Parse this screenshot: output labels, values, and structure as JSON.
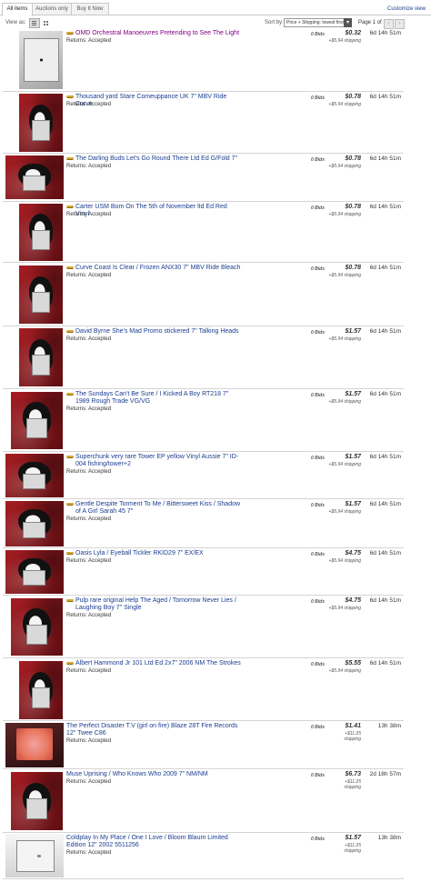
{
  "tabs": [
    "All items",
    "Auctions only",
    "Buy It Now"
  ],
  "customize_label": "Customize view",
  "toolbar": {
    "view_as": "View as:",
    "sort_by": "Sort by:",
    "sort_value": "Price + Shipping: lowest first",
    "page_info": "Page 1 of 1"
  },
  "listings": [
    {
      "title": "OMD Orchestral Manoeuvres Pretending to See The Light",
      "returns": "Returns: Accepted",
      "bids": "0 Bids",
      "price": "$0.32",
      "shipping": "+$5.94 shipping",
      "time": "6d 14h 51m",
      "auction_icon": true,
      "visited": true,
      "thumb": "white"
    },
    {
      "title": "Thousand yard Stare Comeuppance UK 7\" MBV Ride Curve",
      "returns": "Returns: Accepted",
      "bids": "0 Bids",
      "price": "$0.78",
      "shipping": "+$5.94 shipping",
      "time": "6d 14h 51m",
      "auction_icon": true,
      "thumb": "cat"
    },
    {
      "title": "The Darling Buds Let's Go Round There Ltd Ed G/Fold 7\"",
      "returns": "Returns: Accepted",
      "bids": "0 Bids",
      "price": "$0.78",
      "shipping": "+$5.94 shipping",
      "time": "6d 14h 51m",
      "auction_icon": true,
      "thumb": "cat"
    },
    {
      "title": "Carter USM Bom On The 5th of November ltd Ed Red Vinyl",
      "returns": "Returns: Accepted",
      "bids": "0 Bids",
      "price": "$0.78",
      "shipping": "+$5.94 shipping",
      "time": "6d 14h 51m",
      "auction_icon": true,
      "thumb": "cat"
    },
    {
      "title": "Curve Coast Is Clear / Frozen ANX30 7\" MBV Ride Bleach",
      "returns": "Returns: Accepted",
      "bids": "0 Bids",
      "price": "$0.78",
      "shipping": "+$5.94 shipping",
      "time": "6d 14h 51m",
      "auction_icon": true,
      "thumb": "cat"
    },
    {
      "title": "David Byrne She's Mad Promo stickered 7\" Talking Heads",
      "returns": "Returns: Accepted",
      "bids": "0 Bids",
      "price": "$1.57",
      "shipping": "+$5.94 shipping",
      "time": "6d 14h 51m",
      "auction_icon": true,
      "thumb": "cat"
    },
    {
      "title": "The Sundays Can't Be Sure / I Kicked A Boy RT218 7\" 1989 Rough Trade VG/VG",
      "returns": "Returns: Accepted",
      "bids": "0 Bids",
      "price": "$1.57",
      "shipping": "+$5.94 shipping",
      "time": "6d 14h 51m",
      "auction_icon": true,
      "thumb": "cat"
    },
    {
      "title": "Superchunk very rare Tower EP yellow Vinyl Aussie 7\" ID-004 fishing/tower+2",
      "returns": "Returns: Accepted",
      "bids": "0 Bids",
      "price": "$1.57",
      "shipping": "+$5.94 shipping",
      "time": "6d 14h 51m",
      "auction_icon": true,
      "thumb": "cat"
    },
    {
      "title": "Gentle Despite Torment To Me / Bittersweet Kiss / Shadow of A Girl Sarah 45 7\"",
      "returns": "Returns: Accepted",
      "bids": "0 Bids",
      "price": "$1.57",
      "shipping": "+$5.94 shipping",
      "time": "6d 14h 51m",
      "auction_icon": true,
      "thumb": "cat"
    },
    {
      "title": "Oasis Lyla / Eyeball Tickler RKID29 7\" EX/EX",
      "returns": "Returns: Accepted",
      "bids": "0 Bids",
      "price": "$4.75",
      "shipping": "+$5.94 shipping",
      "time": "6d 14h 51m",
      "auction_icon": true,
      "thumb": "cat"
    },
    {
      "title": "Pulp rare original Help The Aged / Tomorrow Never Lies / Laughing Boy 7\" Single",
      "returns": "Returns: Accepted",
      "bids": "0 Bids",
      "price": "$4.75",
      "shipping": "+$5.94 shipping",
      "time": "6d 14h 51m",
      "auction_icon": true,
      "thumb": "cat"
    },
    {
      "title": "Albert Hammond Jr 101 Ltd Ed 2x7\" 2006 NM The Strokes",
      "returns": "Returns: Accepted",
      "bids": "0 Bids",
      "price": "$5.55",
      "shipping": "+$5.94 shipping",
      "time": "6d 14h 51m",
      "auction_icon": true,
      "thumb": "cat"
    },
    {
      "title": "The Perfect Disaster T.V (girl on fire) Blaze 28T Fire Records 12\" Twee C86",
      "returns": "Returns: Accepted",
      "bids": "0 Bids",
      "price": "$1.41",
      "shipping": "+$11.25 shipping",
      "time": "13h 38m",
      "auction_icon": false,
      "thumb": "orange"
    },
    {
      "title": "Muse Uprising / Who Knows Who 2009 7\" NM/NM",
      "returns": "Returns: Accepted",
      "bids": "0 Bids",
      "price": "$6.73",
      "shipping": "+$11.25 shipping",
      "time": "2d 18h 57m",
      "auction_icon": false,
      "thumb": "cat"
    },
    {
      "title": "Coldplay In My Place / One I Love / Bloom Blaum Limited Edition 12\" 2002 5511256",
      "returns": "Returns: Accepted",
      "bids": "0 Bids",
      "price": "$1.57",
      "shipping": "+$11.25 shipping",
      "time": "13h 38m",
      "auction_icon": false,
      "thumb": "white2"
    }
  ]
}
